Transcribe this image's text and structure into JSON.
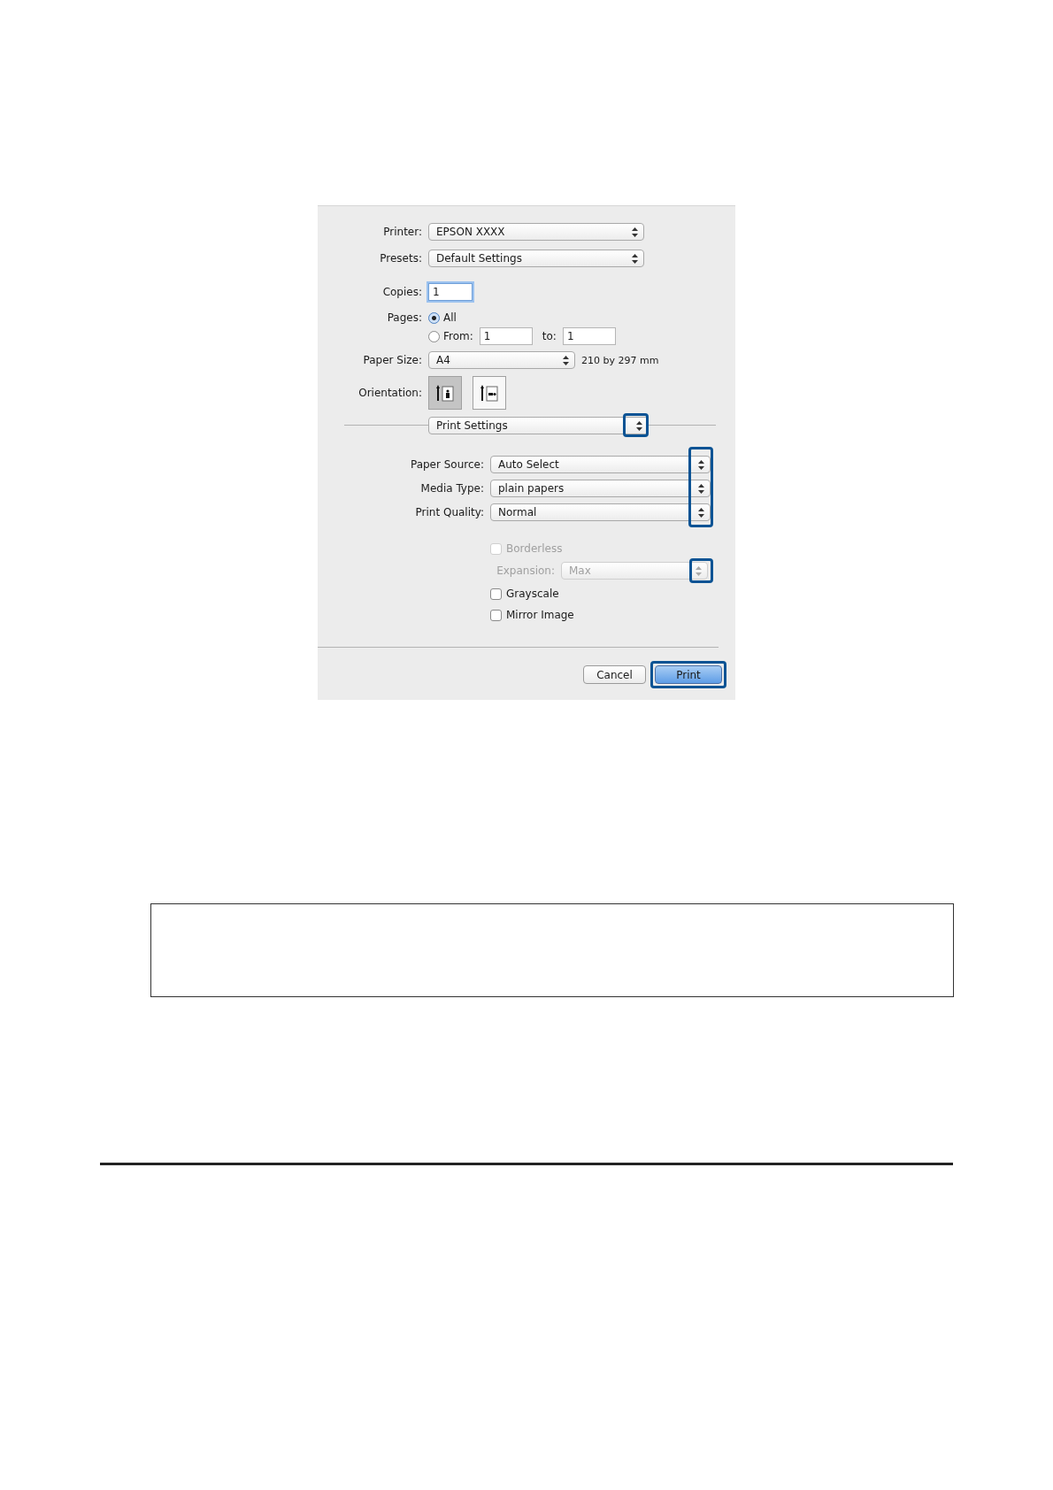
{
  "dialog": {
    "printer": {
      "label": "Printer:",
      "value": "EPSON XXXX"
    },
    "presets": {
      "label": "Presets:",
      "value": "Default Settings"
    },
    "copies": {
      "label": "Copies:",
      "value": "1"
    },
    "pages": {
      "label": "Pages:",
      "options": [
        {
          "label": "All",
          "selected": true
        },
        {
          "label": "From:",
          "selected": false
        }
      ],
      "from": "1",
      "to_label": "to:",
      "to": "1"
    },
    "paper_size": {
      "label": "Paper Size:",
      "value": "A4",
      "note": "210 by 297 mm"
    },
    "orientation": {
      "label": "Orientation:",
      "options": [
        {
          "kind": "portrait",
          "selected": true
        },
        {
          "kind": "landscape",
          "selected": false
        }
      ]
    },
    "section": {
      "value": "Print Settings",
      "highlighted": true
    },
    "settings": {
      "highlighted": true,
      "rows": [
        {
          "label": "Paper Source:",
          "value": "Auto Select"
        },
        {
          "label": "Media Type:",
          "value": "plain papers"
        },
        {
          "label": "Print Quality:",
          "value": "Normal"
        }
      ]
    },
    "borderless": {
      "label": "Borderless",
      "checked": false,
      "disabled": true
    },
    "expansion": {
      "label": "Expansion:",
      "value": "Max",
      "disabled": true,
      "highlighted": true
    },
    "options": [
      {
        "label": "Grayscale",
        "checked": false
      },
      {
        "label": "Mirror Image",
        "checked": false
      }
    ],
    "buttons": [
      {
        "label": "Cancel",
        "kind": "secondary"
      },
      {
        "label": "Print",
        "kind": "default",
        "highlighted": true
      }
    ]
  }
}
